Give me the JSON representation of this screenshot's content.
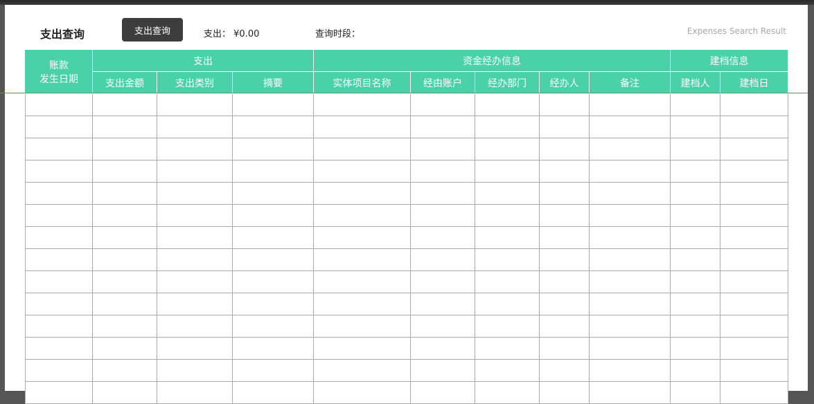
{
  "header": {
    "title": "支出查询",
    "query_button": "支出查询",
    "expense_label": "支出：",
    "expense_value": "¥0.00",
    "period_label": "查询时段：",
    "subtitle": "Expenses Search Result"
  },
  "table": {
    "group_headers": {
      "date_line1": "账款",
      "date_line2": "发生日期",
      "expense": "支出",
      "fund": "资金经办信息",
      "archive": "建档信息"
    },
    "columns": [
      "支出金额",
      "支出类别",
      "摘要",
      "实体项目名称",
      "经由账户",
      "经办部门",
      "经办人",
      "备注",
      "建档人",
      "建档日"
    ],
    "row_count": 14
  },
  "colors": {
    "header_bg": "#4ad1a7",
    "button_bg": "#3d3d3d"
  }
}
